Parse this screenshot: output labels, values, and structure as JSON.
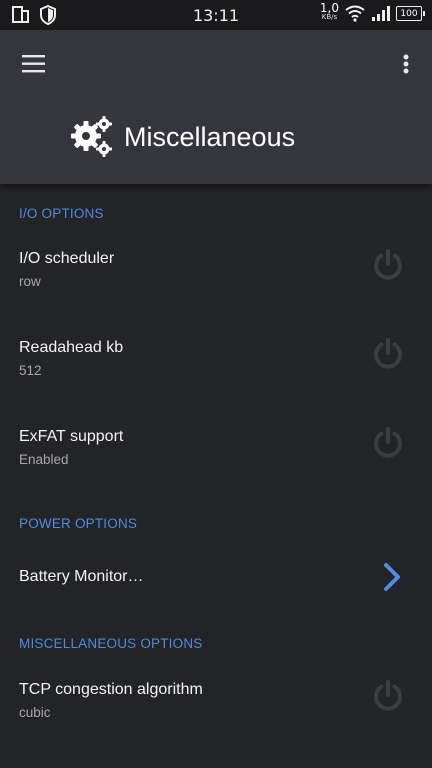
{
  "status_bar": {
    "time": "13:11",
    "net_speed_value": "1,0",
    "net_speed_unit": "KB/s",
    "battery": "100"
  },
  "header": {
    "title": "Miscellaneous",
    "icon": "gears-icon"
  },
  "sections": [
    {
      "title": "I/O OPTIONS",
      "items": [
        {
          "title": "I/O scheduler",
          "value": "row",
          "control": "power-icon"
        },
        {
          "title": "Readahead kb",
          "value": "512",
          "control": "power-icon"
        },
        {
          "title": "ExFAT support",
          "value": "Enabled",
          "control": "power-icon"
        }
      ]
    },
    {
      "title": "POWER OPTIONS",
      "items": [
        {
          "title": "Battery Monitor…",
          "control": "chevron-right-icon"
        }
      ]
    },
    {
      "title": "MISCELLANEOUS OPTIONS",
      "items": [
        {
          "title": "TCP congestion algorithm",
          "value": "cubic",
          "control": "power-icon"
        }
      ]
    }
  ],
  "colors": {
    "background": "#232428",
    "header": "#35363d",
    "accent": "#4f8be0",
    "power_icon": "#3c3d42"
  }
}
